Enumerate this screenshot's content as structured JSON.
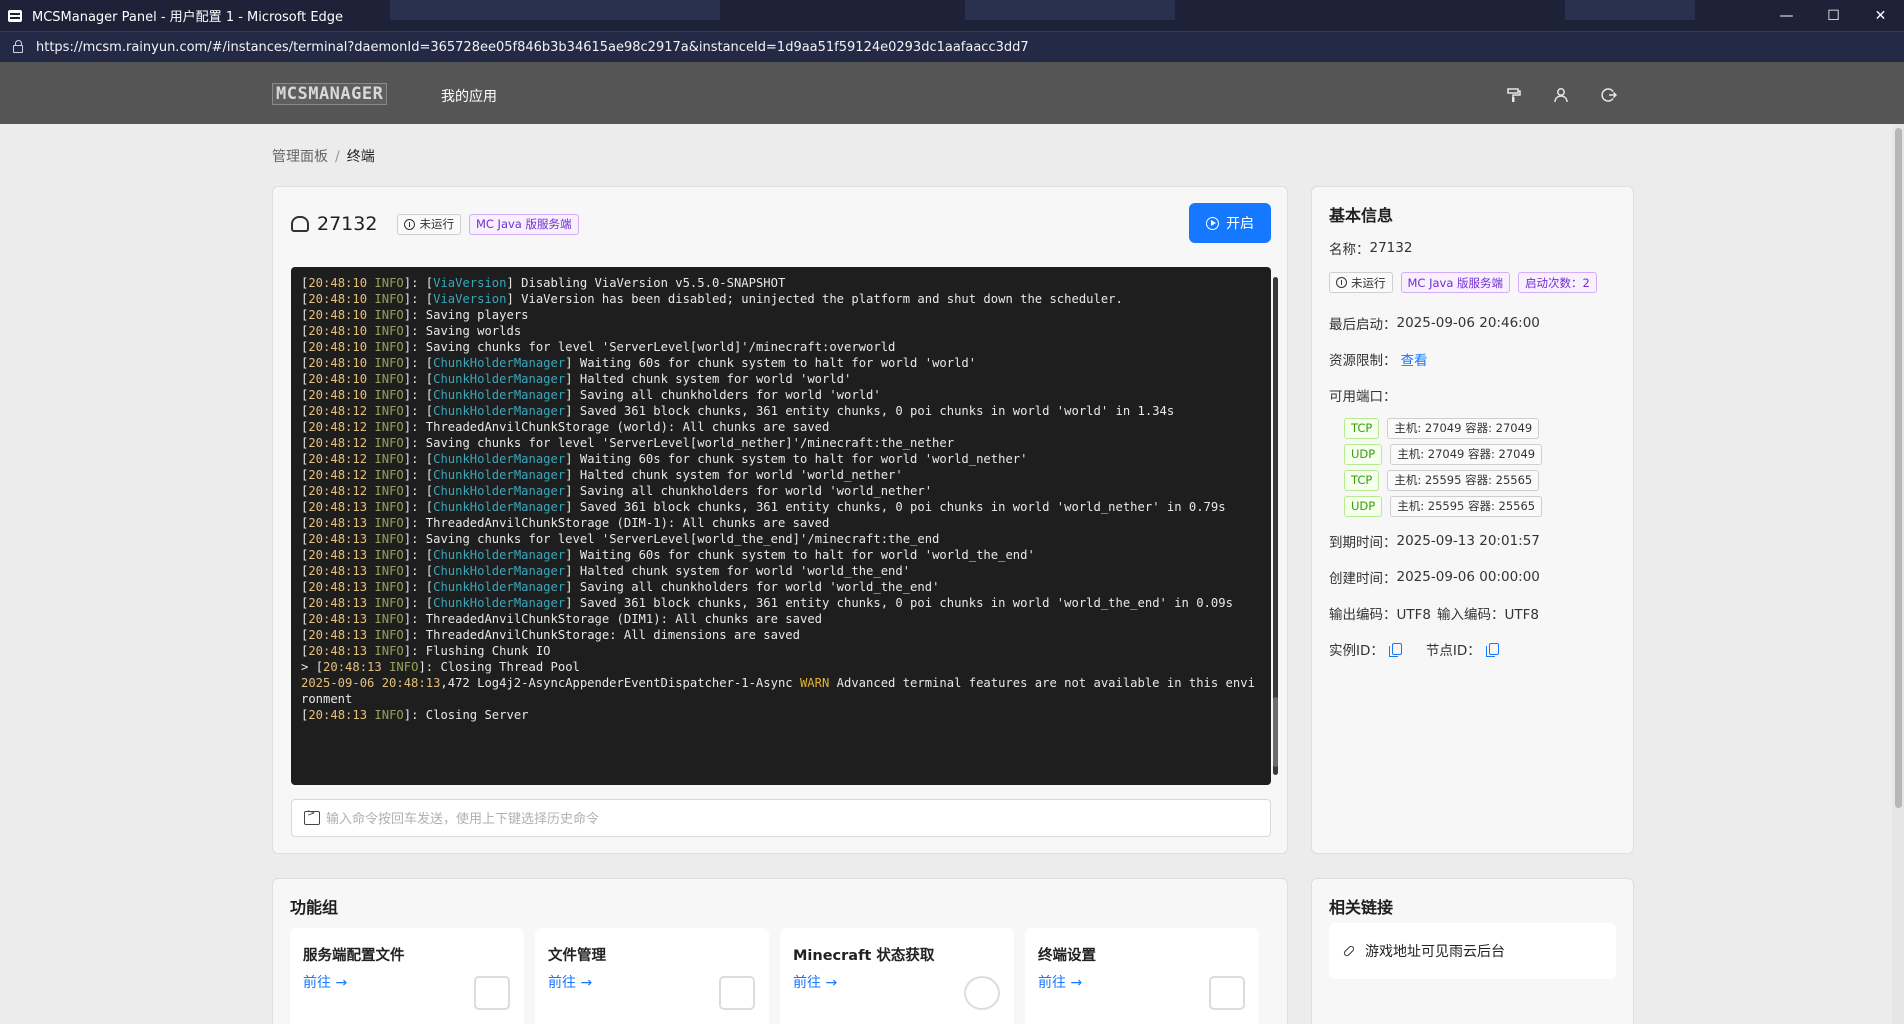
{
  "window": {
    "title": "MCSManager Panel - 用户配置 1 - Microsoft Edge",
    "controls": [
      "—",
      "☐",
      "✕"
    ]
  },
  "address_bar": {
    "url": "https://mcsm.rainyun.com/#/instances/terminal?daemonId=365728ee05f846b3b34615ae98c2917a&instanceId=1d9aa51f59124e0293dc1aafaacc3dd7"
  },
  "header": {
    "logo": "MCSMANAGER",
    "nav_apps": "我的应用",
    "icons": [
      "paint-roller-icon",
      "user-icon",
      "logout-icon"
    ]
  },
  "breadcrumb": {
    "root": "管理面板",
    "separator": "/",
    "current": "终端"
  },
  "instance": {
    "name": "27132",
    "status": "未运行",
    "type": "MC Java 版服务端",
    "start_label": "开启"
  },
  "terminal": {
    "lines": [
      {
        "t": "20:48:10",
        "lvl": "INFO",
        "src": "ViaVersion",
        "msg": "Disabling ViaVersion v5.5.0-SNAPSHOT"
      },
      {
        "t": "20:48:10",
        "lvl": "INFO",
        "src": "ViaVersion",
        "msg": "ViaVersion has been disabled; uninjected the platform and shut down the scheduler."
      },
      {
        "t": "20:48:10",
        "lvl": "INFO",
        "src": "",
        "msg": "Saving players"
      },
      {
        "t": "20:48:10",
        "lvl": "INFO",
        "src": "",
        "msg": "Saving worlds"
      },
      {
        "t": "20:48:10",
        "lvl": "INFO",
        "src": "",
        "msg": "Saving chunks for level 'ServerLevel[world]'/minecraft:overworld"
      },
      {
        "t": "20:48:10",
        "lvl": "INFO",
        "src": "ChunkHolderManager",
        "msg": "Waiting 60s for chunk system to halt for world 'world'"
      },
      {
        "t": "20:48:10",
        "lvl": "INFO",
        "src": "ChunkHolderManager",
        "msg": "Halted chunk system for world 'world'"
      },
      {
        "t": "20:48:10",
        "lvl": "INFO",
        "src": "ChunkHolderManager",
        "msg": "Saving all chunkholders for world 'world'"
      },
      {
        "t": "20:48:12",
        "lvl": "INFO",
        "src": "ChunkHolderManager",
        "msg": "Saved 361 block chunks, 361 entity chunks, 0 poi chunks in world 'world' in 1.34s"
      },
      {
        "t": "20:48:12",
        "lvl": "INFO",
        "src": "",
        "msg": "ThreadedAnvilChunkStorage (world): All chunks are saved"
      },
      {
        "t": "20:48:12",
        "lvl": "INFO",
        "src": "",
        "msg": "Saving chunks for level 'ServerLevel[world_nether]'/minecraft:the_nether"
      },
      {
        "t": "20:48:12",
        "lvl": "INFO",
        "src": "ChunkHolderManager",
        "msg": "Waiting 60s for chunk system to halt for world 'world_nether'"
      },
      {
        "t": "20:48:12",
        "lvl": "INFO",
        "src": "ChunkHolderManager",
        "msg": "Halted chunk system for world 'world_nether'"
      },
      {
        "t": "20:48:12",
        "lvl": "INFO",
        "src": "ChunkHolderManager",
        "msg": "Saving all chunkholders for world 'world_nether'"
      },
      {
        "t": "20:48:13",
        "lvl": "INFO",
        "src": "ChunkHolderManager",
        "msg": "Saved 361 block chunks, 361 entity chunks, 0 poi chunks in world 'world_nether' in 0.79s"
      },
      {
        "t": "20:48:13",
        "lvl": "INFO",
        "src": "",
        "msg": "ThreadedAnvilChunkStorage (DIM-1): All chunks are saved"
      },
      {
        "t": "20:48:13",
        "lvl": "INFO",
        "src": "",
        "msg": "Saving chunks for level 'ServerLevel[world_the_end]'/minecraft:the_end"
      },
      {
        "t": "20:48:13",
        "lvl": "INFO",
        "src": "ChunkHolderManager",
        "msg": "Waiting 60s for chunk system to halt for world 'world_the_end'"
      },
      {
        "t": "20:48:13",
        "lvl": "INFO",
        "src": "ChunkHolderManager",
        "msg": "Halted chunk system for world 'world_the_end'"
      },
      {
        "t": "20:48:13",
        "lvl": "INFO",
        "src": "ChunkHolderManager",
        "msg": "Saving all chunkholders for world 'world_the_end'"
      },
      {
        "t": "20:48:13",
        "lvl": "INFO",
        "src": "ChunkHolderManager",
        "msg": "Saved 361 block chunks, 361 entity chunks, 0 poi chunks in world 'world_the_end' in 0.09s"
      },
      {
        "t": "20:48:13",
        "lvl": "INFO",
        "src": "",
        "msg": "ThreadedAnvilChunkStorage (DIM1): All chunks are saved"
      },
      {
        "t": "20:48:13",
        "lvl": "INFO",
        "src": "",
        "msg": "ThreadedAnvilChunkStorage: All dimensions are saved"
      },
      {
        "t": "20:48:13",
        "lvl": "INFO",
        "src": "",
        "msg": "Flushing Chunk IO"
      },
      {
        "prefix": "> ",
        "t": "20:48:13",
        "lvl": "INFO",
        "src": "",
        "msg": "Closing Thread Pool"
      },
      {
        "raw_date": "2025-09-06 20:48:13",
        "raw_ms": ",472",
        "raw_thread": " Log4j2-AsyncAppenderEventDispatcher-1-Async ",
        "raw_lvl": "WARN",
        "msg": " Advanced terminal features are not available in this environment"
      },
      {
        "t": "20:48:13",
        "lvl": "INFO",
        "src": "",
        "msg": "Closing Server"
      }
    ]
  },
  "command_input": {
    "placeholder": "输入命令按回车发送，使用上下键选择历史命令",
    "value": ""
  },
  "basic_info": {
    "title": "基本信息",
    "name_label": "名称：",
    "name_value": "27132",
    "status": "未运行",
    "type": "MC Java 版服务端",
    "start_count": "启动次数：2",
    "last_start_label": "最后启动：",
    "last_start_value": "2025-09-06 20:46:00",
    "resource_label": "资源限制：",
    "resource_link": "查看",
    "ports_label": "可用端口：",
    "ports": [
      {
        "proto": "TCP",
        "detail": "主机: 27049 容器: 27049"
      },
      {
        "proto": "UDP",
        "detail": "主机: 27049 容器: 27049"
      },
      {
        "proto": "TCP",
        "detail": "主机: 25595 容器: 25565"
      },
      {
        "proto": "UDP",
        "detail": "主机: 25595 容器: 25565"
      }
    ],
    "expire_label": "到期时间：",
    "expire_value": "2025-09-13 20:01:57",
    "created_label": "创建时间：",
    "created_value": "2025-09-06 00:00:00",
    "output_enc": "输出编码：UTF8",
    "input_enc": "输入编码：UTF8",
    "instance_id_label": "实例ID：",
    "node_id_label": "节点ID："
  },
  "function_group": {
    "title": "功能组",
    "items": [
      {
        "name": "服务端配置文件",
        "go": "前往 →"
      },
      {
        "name": "文件管理",
        "go": "前往 →"
      },
      {
        "name": "Minecraft 状态获取",
        "go": "前往 →"
      },
      {
        "name": "终端设置",
        "go": "前往 →"
      }
    ]
  },
  "related_links": {
    "title": "相关链接",
    "item": "游戏地址可见雨云后台"
  },
  "colors": {
    "accent": "#1677ff",
    "terminal_bg": "#1e1e1e",
    "header_bg": "#555555",
    "titlebar_bg": "#1d2238"
  }
}
